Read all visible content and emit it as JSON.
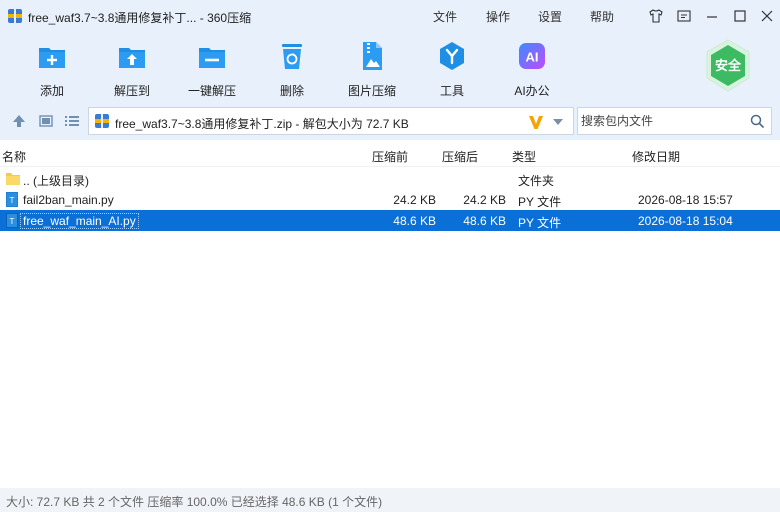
{
  "titlebar": {
    "title": "free_waf3.7~3.8通用修复补丁... - 360压缩",
    "menus": [
      "文件",
      "操作",
      "设置",
      "帮助"
    ]
  },
  "toolbar": {
    "tools": [
      {
        "label": "添加",
        "icon": "add-file-icon"
      },
      {
        "label": "解压到",
        "icon": "extract-to-icon"
      },
      {
        "label": "一键解压",
        "icon": "one-click-extract-icon"
      },
      {
        "label": "删除",
        "icon": "delete-icon"
      },
      {
        "label": "图片压缩",
        "icon": "image-compress-icon"
      },
      {
        "label": "工具",
        "icon": "tools-icon"
      },
      {
        "label": "AI办公",
        "icon": "ai-office-icon"
      }
    ],
    "ai_icon_text": "AI",
    "safe_badge": "安全"
  },
  "addressbar": {
    "path": "free_waf3.7~3.8通用修复补丁.zip - 解包大小为 72.7 KB",
    "search_placeholder": "搜索包内文件"
  },
  "list": {
    "columns": [
      "名称",
      "压缩前",
      "压缩后",
      "类型",
      "修改日期"
    ],
    "rows": [
      {
        "name": ".. (上级目录)",
        "before": "",
        "after": "",
        "type": "文件夹",
        "date": "",
        "icon": "folder-icon"
      },
      {
        "name": "fail2ban_main.py",
        "before": "24.2 KB",
        "after": "24.2 KB",
        "type": "PY 文件",
        "date": "2026-08-18 15:57",
        "icon": "py-file-icon"
      },
      {
        "name": "free_waf_main_AI.py",
        "before": "48.6 KB",
        "after": "48.6 KB",
        "type": "PY 文件",
        "date": "2026-08-18 15:04",
        "icon": "py-file-icon"
      }
    ],
    "selected_index": 2
  },
  "status": {
    "text": "大小: 72.7 KB 共 2 个文件 压缩率 100.0% 已经选择 48.6 KB (1 个文件)"
  },
  "colors": {
    "chrome_bg": "#e8f1fb",
    "accent": "#0a6fd6",
    "toolbar_icon": "#1f8fe6",
    "safe_green": "#3dbb63"
  }
}
